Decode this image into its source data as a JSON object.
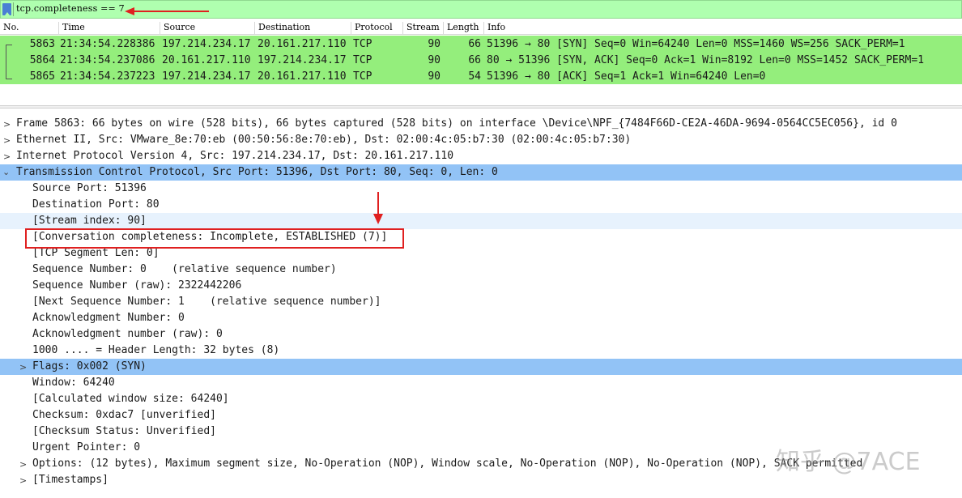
{
  "filter": {
    "text": "tcp.completeness == 7"
  },
  "columns": [
    "No.",
    "Time",
    "Source",
    "Destination",
    "Protocol",
    "Stream",
    "Length",
    "Info"
  ],
  "packets": [
    {
      "no": "5863",
      "time": "21:34:54.228386",
      "source": "197.214.234.17",
      "destination": "20.161.217.110",
      "protocol": "TCP",
      "stream": "90",
      "length": "66",
      "info": "51396 → 80 [SYN] Seq=0 Win=64240 Len=0 MSS=1460 WS=256 SACK_PERM=1"
    },
    {
      "no": "5864",
      "time": "21:34:54.237086",
      "source": "20.161.217.110",
      "destination": "197.214.234.17",
      "protocol": "TCP",
      "stream": "90",
      "length": "66",
      "info": "80 → 51396 [SYN, ACK] Seq=0 Ack=1 Win=8192 Len=0 MSS=1452 SACK_PERM=1"
    },
    {
      "no": "5865",
      "time": "21:34:54.237223",
      "source": "197.214.234.17",
      "destination": "20.161.217.110",
      "protocol": "TCP",
      "stream": "90",
      "length": "54",
      "info": "51396 → 80 [ACK] Seq=1 Ack=1 Win=64240 Len=0"
    }
  ],
  "details": {
    "frame": "Frame 5863: 66 bytes on wire (528 bits), 66 bytes captured (528 bits) on interface \\Device\\NPF_{7484F66D-CE2A-46DA-9694-0564CC5EC056}, id 0",
    "ethernet": "Ethernet II, Src: VMware_8e:70:eb (00:50:56:8e:70:eb), Dst: 02:00:4c:05:b7:30 (02:00:4c:05:b7:30)",
    "ip": "Internet Protocol Version 4, Src: 197.214.234.17, Dst: 20.161.217.110",
    "tcp": "Transmission Control Protocol, Src Port: 51396, Dst Port: 80, Seq: 0, Len: 0",
    "tcp_fields": [
      "Source Port: 51396",
      "Destination Port: 80",
      "[Stream index: 90]",
      "[Conversation completeness: Incomplete, ESTABLISHED (7)]",
      "[TCP Segment Len: 0]",
      "Sequence Number: 0    (relative sequence number)",
      "Sequence Number (raw): 2322442206",
      "[Next Sequence Number: 1    (relative sequence number)]",
      "Acknowledgment Number: 0",
      "Acknowledgment number (raw): 0",
      "1000 .... = Header Length: 32 bytes (8)",
      "Flags: 0x002 (SYN)",
      "Window: 64240",
      "[Calculated window size: 64240]",
      "Checksum: 0xdac7 [unverified]",
      "[Checksum Status: Unverified]",
      "Urgent Pointer: 0",
      "Options: (12 bytes), Maximum segment size, No-Operation (NOP), Window scale, No-Operation (NOP), No-Operation (NOP), SACK permitted",
      "[Timestamps]"
    ]
  },
  "watermark": "知乎 @7ACE",
  "colors": {
    "filter_bg": "#afffaf",
    "row_green": "#94ee7c",
    "selected_blue": "#92c3f6",
    "alt_blue": "#e7f2fd",
    "annotation_red": "#e02020"
  }
}
